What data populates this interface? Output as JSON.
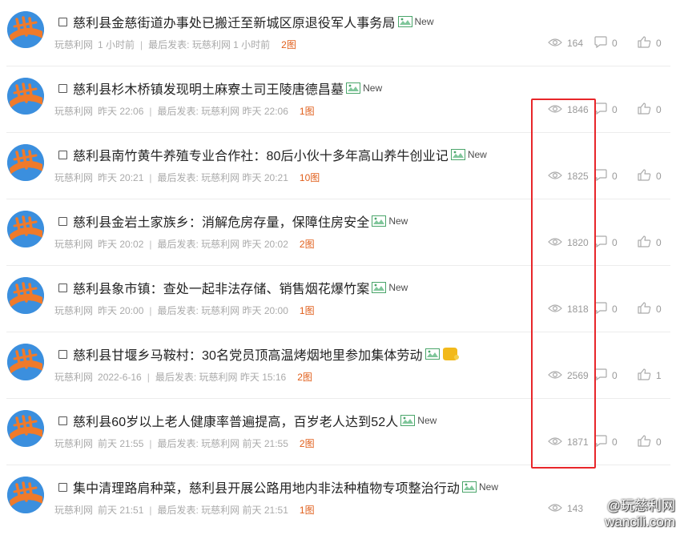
{
  "threads": [
    {
      "title": "慈利县金慈街道办事处已搬迁至新城区原退役军人事务局",
      "badge": "New",
      "badge_type": "new",
      "author": "玩慈利网",
      "time": "1 小时前",
      "last_post": "最后发表: 玩慈利网 1 小时前",
      "pics": "2图",
      "views": "164",
      "replies": "0",
      "likes": "0"
    },
    {
      "title": "慈利县杉木桥镇发现明土麻寮土司王陵唐德昌墓",
      "badge": "New",
      "badge_type": "new",
      "author": "玩慈利网",
      "time": "昨天 22:06",
      "last_post": "最后发表: 玩慈利网 昨天 22:06",
      "pics": "1图",
      "views": "1846",
      "replies": "0",
      "likes": "0"
    },
    {
      "title": "慈利县南竹黄牛养殖专业合作社：80后小伙十多年高山养牛创业记",
      "badge": "New",
      "badge_type": "new",
      "author": "玩慈利网",
      "time": "昨天 20:21",
      "last_post": "最后发表: 玩慈利网 昨天 20:21",
      "pics": "10图",
      "views": "1825",
      "replies": "0",
      "likes": "0"
    },
    {
      "title": "慈利县金岩土家族乡：消解危房存量，保障住房安全",
      "badge": "New",
      "badge_type": "new",
      "author": "玩慈利网",
      "time": "昨天 20:02",
      "last_post": "最后发表: 玩慈利网 昨天 20:02",
      "pics": "2图",
      "views": "1820",
      "replies": "0",
      "likes": "0"
    },
    {
      "title": "慈利县象市镇：查处一起非法存储、销售烟花爆竹案",
      "badge": "New",
      "badge_type": "new",
      "author": "玩慈利网",
      "time": "昨天 20:00",
      "last_post": "最后发表: 玩慈利网 昨天 20:00",
      "pics": "1图",
      "views": "1818",
      "replies": "0",
      "likes": "0"
    },
    {
      "title": "慈利县甘堰乡马鞍村：30名党员顶高温烤烟地里参加集体劳动",
      "badge": "精",
      "badge_type": "jing",
      "author": "玩慈利网",
      "time": "2022-6-16",
      "last_post": "最后发表: 玩慈利网 昨天 15:16",
      "pics": "2图",
      "views": "2569",
      "replies": "0",
      "likes": "1"
    },
    {
      "title": "慈利县60岁以上老人健康率普遍提高，百岁老人达到52人",
      "badge": "New",
      "badge_type": "new",
      "author": "玩慈利网",
      "time": "前天 21:55",
      "last_post": "最后发表: 玩慈利网 前天 21:55",
      "pics": "2图",
      "views": "1871",
      "replies": "0",
      "likes": "0"
    },
    {
      "title": "集中清理路肩种菜，慈利县开展公路用地内非法种植物专项整治行动",
      "badge": "New",
      "badge_type": "new",
      "author": "玩慈利网",
      "time": "前天 21:51",
      "last_post": "最后发表: 玩慈利网 前天 21:51",
      "pics": "1图",
      "views": "143",
      "replies": "",
      "likes": ""
    }
  ],
  "watermark": {
    "line1": "@玩慈利网",
    "line2": "wancili.com"
  },
  "colors": {
    "pics": "#e05e1a",
    "highlight_box": "#e8262a",
    "avatar_bg": "#3b8fde",
    "avatar_mark": "#f07a2a"
  },
  "icons": {
    "views": "eye-icon",
    "replies": "comment-icon",
    "likes": "thumbs-up-icon",
    "image": "image-icon"
  }
}
